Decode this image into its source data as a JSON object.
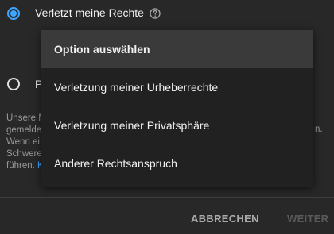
{
  "options": [
    {
      "label": "Verletzt meine Rechte",
      "selected": true
    },
    {
      "label": "P",
      "selected": false
    }
  ],
  "info": {
    "lines": [
      "Unsere M",
      "gemelde",
      "Wenn ei",
      "Schwere",
      "führen."
    ],
    "trailing_right": "n.",
    "link_text": "K"
  },
  "dropdown": {
    "items": [
      {
        "label": "Option auswählen",
        "highlighted": true
      },
      {
        "label": "Verletzung meiner Urheberrechte",
        "highlighted": false
      },
      {
        "label": "Verletzung meiner Privatsphäre",
        "highlighted": false
      },
      {
        "label": "Anderer Rechtsanspruch",
        "highlighted": false
      }
    ]
  },
  "footer": {
    "cancel_label": "ABBRECHEN",
    "next_label": "WEITER"
  },
  "colors": {
    "accent": "#3ea6ff",
    "background": "#282828",
    "dropdown_bg": "#212121",
    "highlight_bg": "#3a3a3a"
  },
  "icons": [
    "help-icon"
  ]
}
